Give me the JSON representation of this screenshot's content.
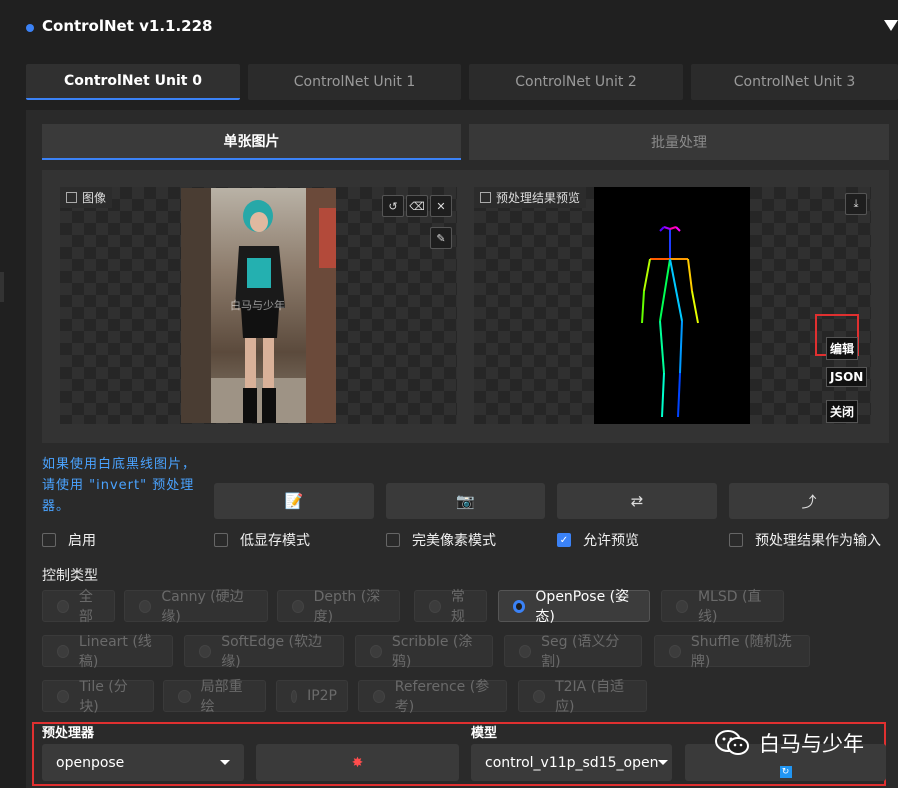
{
  "header": {
    "title": "ControlNet v1.1.228"
  },
  "unit_tabs": [
    "ControlNet Unit 0",
    "ControlNet Unit 1",
    "ControlNet Unit 2",
    "ControlNet Unit 3"
  ],
  "mode_tabs": [
    "单张图片",
    "批量处理"
  ],
  "image_box": {
    "label": "图像",
    "watermark": "白马与少年"
  },
  "preview_box": {
    "label": "预处理结果预览",
    "buttons": [
      "编辑",
      "JSON",
      "关闭"
    ]
  },
  "hint": "如果使用白底黑线图片，请使用 \"invert\" 预处理器。",
  "checkboxes": [
    {
      "label": "启用",
      "checked": false
    },
    {
      "label": "低显存模式",
      "checked": false
    },
    {
      "label": "完美像素模式",
      "checked": false
    },
    {
      "label": "允许预览",
      "checked": true
    },
    {
      "label": "预处理结果作为输入",
      "checked": false
    }
  ],
  "control_type": {
    "label": "控制类型",
    "options": [
      "全部",
      "Canny (硬边缘)",
      "Depth (深度)",
      "常规",
      "OpenPose (姿态)",
      "MLSD (直线)",
      "Lineart (线稿)",
      "SoftEdge (软边缘)",
      "Scribble (涂鸦)",
      "Seg (语义分割)",
      "Shuffle (随机洗牌)",
      "Tile (分块)",
      "局部重绘",
      "IP2P",
      "Reference (参考)",
      "T2IA (自适应)"
    ],
    "selected": "OpenPose (姿态)"
  },
  "preprocessor": {
    "label": "预处理器",
    "value": "openpose"
  },
  "model": {
    "label": "模型",
    "value": "control_v11p_sd15_open"
  },
  "watermark_brand": "白马与少年",
  "colors": {
    "accent": "#3b82f6",
    "highlight": "#e03030"
  }
}
